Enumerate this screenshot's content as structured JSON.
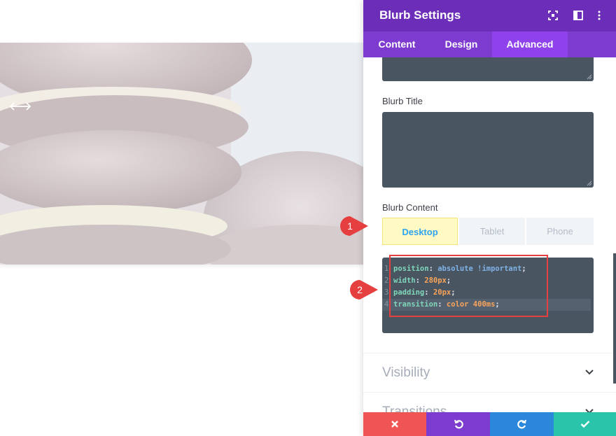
{
  "panel": {
    "title": "Blurb Settings",
    "tabs": [
      "Content",
      "Design",
      "Advanced"
    ],
    "active_tab": "Advanced"
  },
  "fields": {
    "blurb_title_label": "Blurb Title",
    "blurb_content_label": "Blurb Content"
  },
  "device_tabs": [
    "Desktop",
    "Tablet",
    "Phone"
  ],
  "active_device": "Desktop",
  "css_lines": [
    {
      "num": "1",
      "prop": "position",
      "value": "absolute",
      "important": "!important"
    },
    {
      "num": "2",
      "prop": "width",
      "value": "280px",
      "important": ""
    },
    {
      "num": "3",
      "prop": "padding",
      "value": "20px",
      "important": ""
    },
    {
      "num": "4",
      "prop": "transition",
      "value": "color 400ms",
      "important": ""
    }
  ],
  "sections": {
    "visibility": "Visibility",
    "transitions": "Transitions"
  },
  "markers": {
    "first": "1",
    "second": "2"
  },
  "colors": {
    "header": "#6c2eb9",
    "tabs_bar": "#7e3bd0",
    "active_tab": "#8f42ec",
    "close": "#ef5555",
    "undo": "#7d3bcf",
    "redo": "#2b87da",
    "save": "#29c4a9",
    "marker": "#e53f3f"
  },
  "icons": {
    "header": [
      "fullscreen-icon",
      "split-view-icon",
      "more-options-icon"
    ],
    "actions": [
      "close-icon",
      "undo-icon",
      "redo-icon",
      "check-icon"
    ]
  }
}
